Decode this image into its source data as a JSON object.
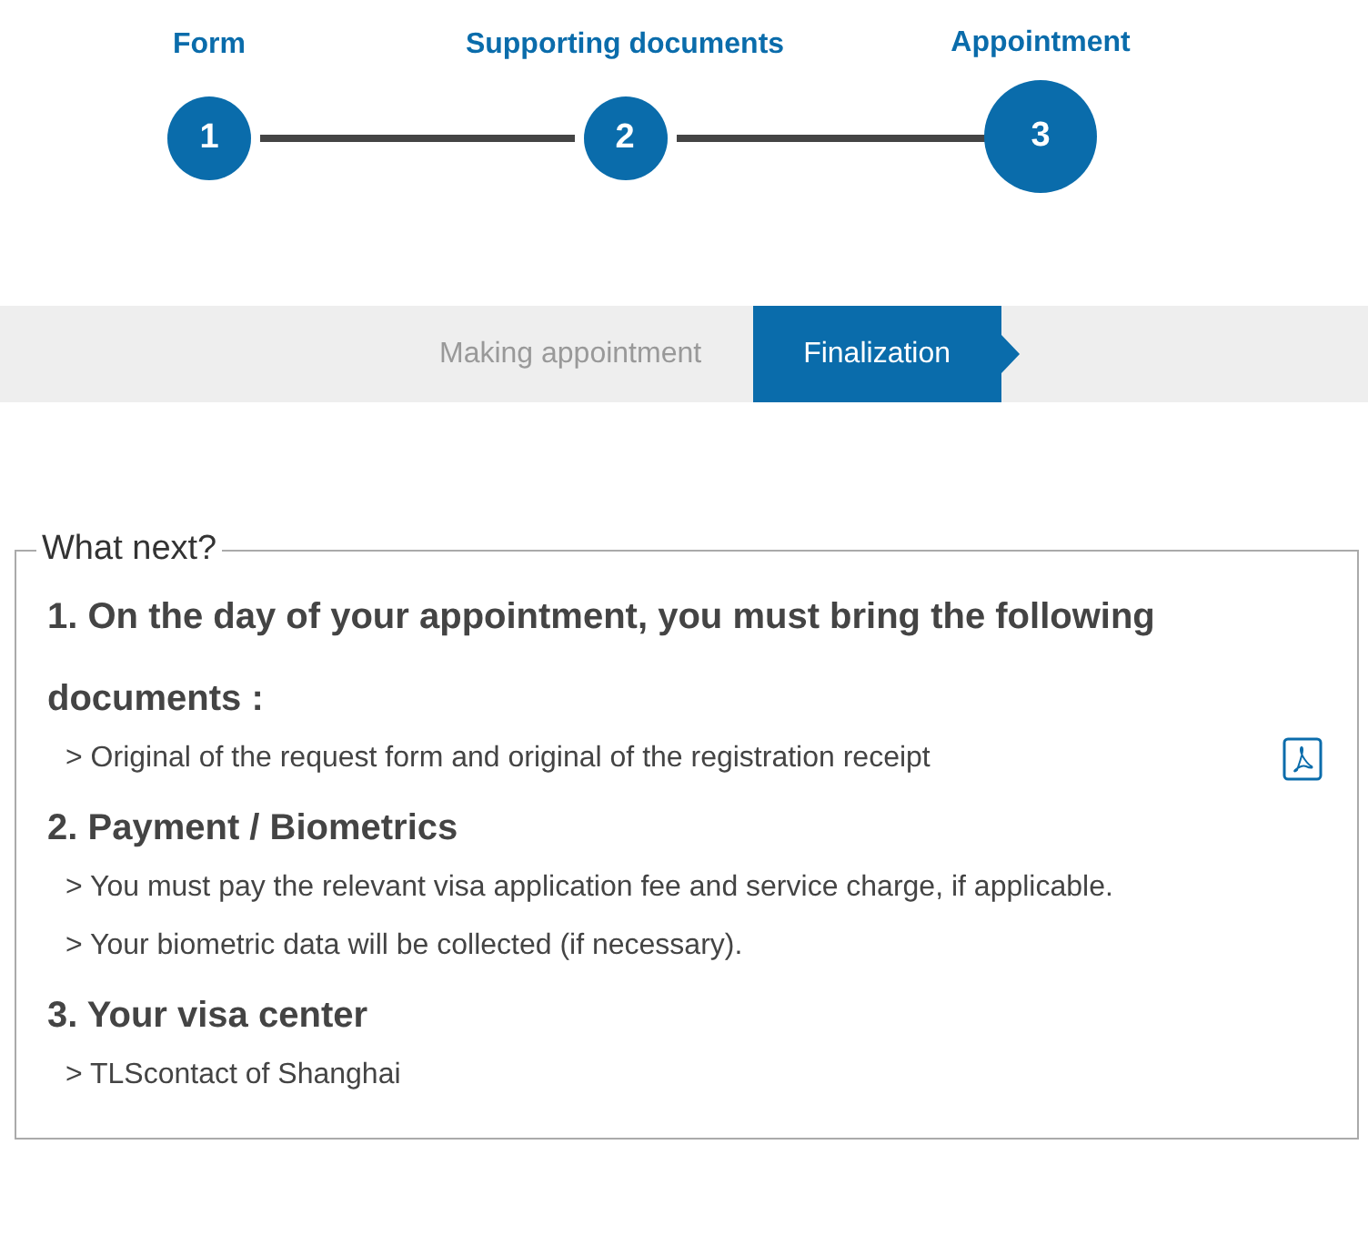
{
  "steps": [
    {
      "number": "1",
      "label": "Form",
      "selected": false
    },
    {
      "number": "2",
      "label": "Supporting documents",
      "selected": false
    },
    {
      "number": "3",
      "label": "Appointment",
      "selected": true
    }
  ],
  "substeps": [
    {
      "label": "Making appointment",
      "selected": false
    },
    {
      "label": "Finalization",
      "selected": true
    }
  ],
  "panel": {
    "legend": "What next?",
    "sections": [
      {
        "heading": "1. On the day of your appointment, you must bring the following documents :",
        "items": [
          {
            "kind": "document",
            "text": "> Original of the request form and original of the registration receipt"
          }
        ]
      },
      {
        "heading": "2. Payment / Biometrics",
        "items": [
          {
            "kind": "note",
            "text": "> You must pay the relevant visa application fee and service charge, if applicable."
          },
          {
            "kind": "note",
            "text": "> Your biometric data will be collected (if necessary)."
          }
        ]
      },
      {
        "heading": "3. Your visa center",
        "items": [
          {
            "kind": "note",
            "text": "> TLScontact of Shanghai"
          }
        ]
      }
    ]
  }
}
